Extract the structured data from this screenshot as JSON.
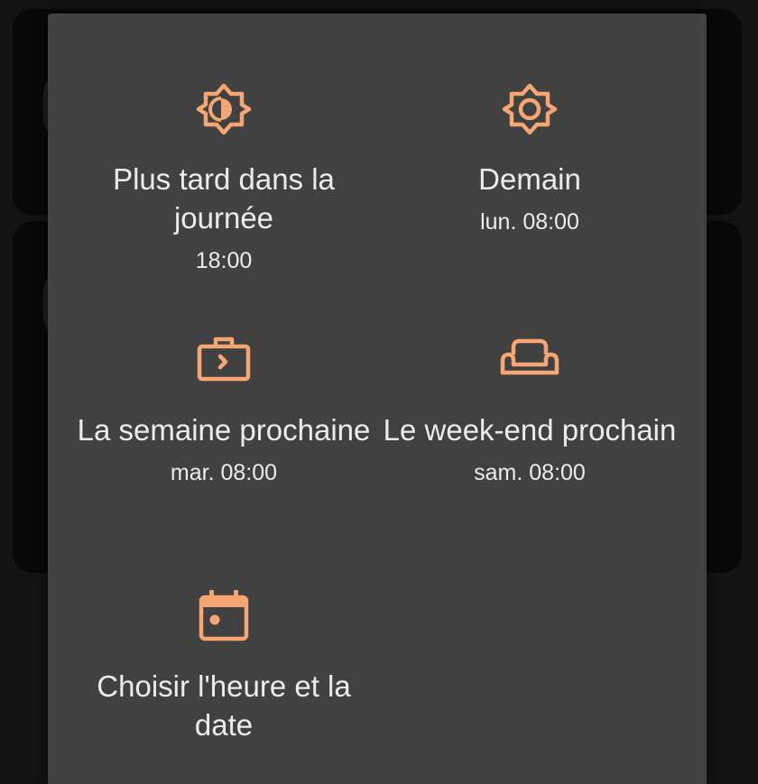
{
  "colors": {
    "accent": "#f5a672",
    "sheet": "#414141",
    "text": "#ececec"
  },
  "snooze_options": [
    {
      "label": "Plus tard dans la journée",
      "time": "18:00",
      "icon": "brightness-half-icon"
    },
    {
      "label": "Demain",
      "time": "lun. 08:00",
      "icon": "brightness-icon"
    },
    {
      "label": "La semaine prochaine",
      "time": "mar. 08:00",
      "icon": "briefcase-icon"
    },
    {
      "label": "Le week-end prochain",
      "time": "sam. 08:00",
      "icon": "sofa-icon"
    },
    {
      "label": "Choisir l'heure et la date",
      "icon": "calendar-icon"
    }
  ]
}
